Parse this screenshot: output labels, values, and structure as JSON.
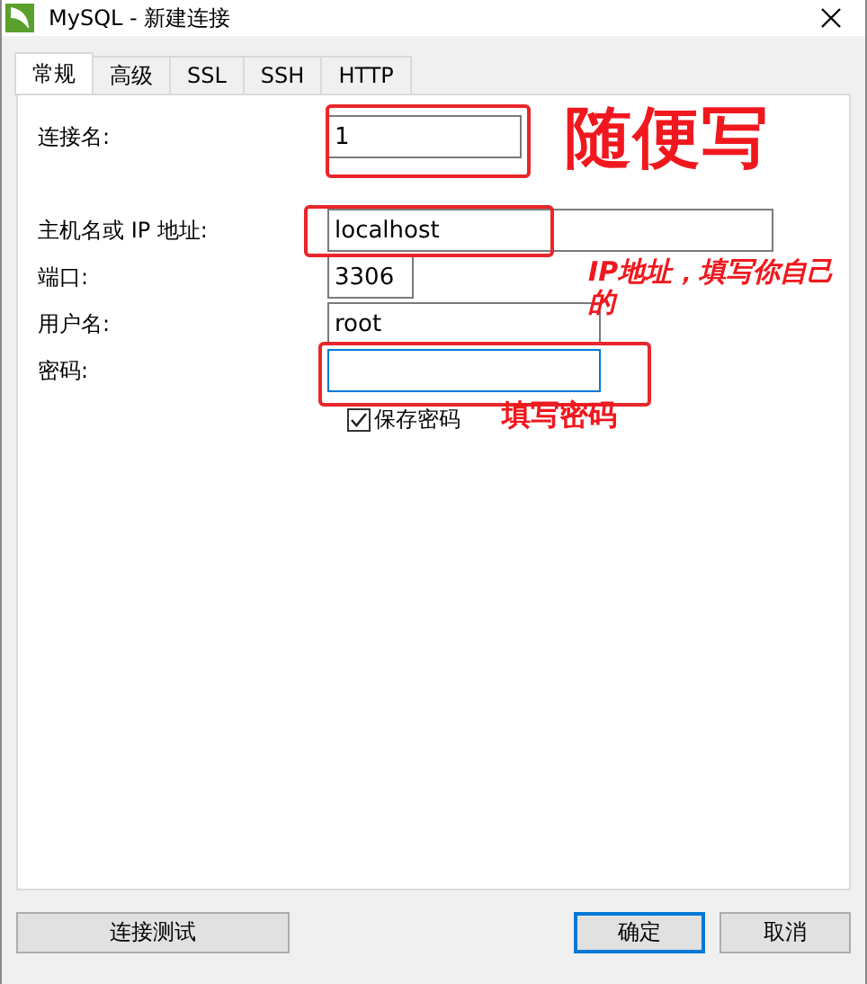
{
  "window": {
    "title": "MySQL - 新建连接"
  },
  "tabs": [
    {
      "label": "常规",
      "selected": true
    },
    {
      "label": "高级",
      "selected": false
    },
    {
      "label": "SSL",
      "selected": false
    },
    {
      "label": "SSH",
      "selected": false
    },
    {
      "label": "HTTP",
      "selected": false
    }
  ],
  "fields": [
    {
      "label": "连接名:",
      "value": "1",
      "focused": false
    },
    {
      "label": "主机名或 IP 地址:",
      "value": "localhost",
      "focused": false
    },
    {
      "label": "端口:",
      "value": "3306",
      "focused": false
    },
    {
      "label": "用户名:",
      "value": "root",
      "focused": false
    },
    {
      "label": "密码:",
      "focused": true
    }
  ],
  "save_password": {
    "label": "保存密码",
    "checked": true
  },
  "annotations": [
    {
      "text": "随便写"
    },
    {
      "text": "IP地址，填写你自己的"
    },
    {
      "text": "填写密码"
    }
  ],
  "buttons": [
    {
      "label": "连接测试",
      "default": false
    },
    {
      "label": "确定",
      "default": true
    },
    {
      "label": "取消",
      "default": false
    }
  ]
}
